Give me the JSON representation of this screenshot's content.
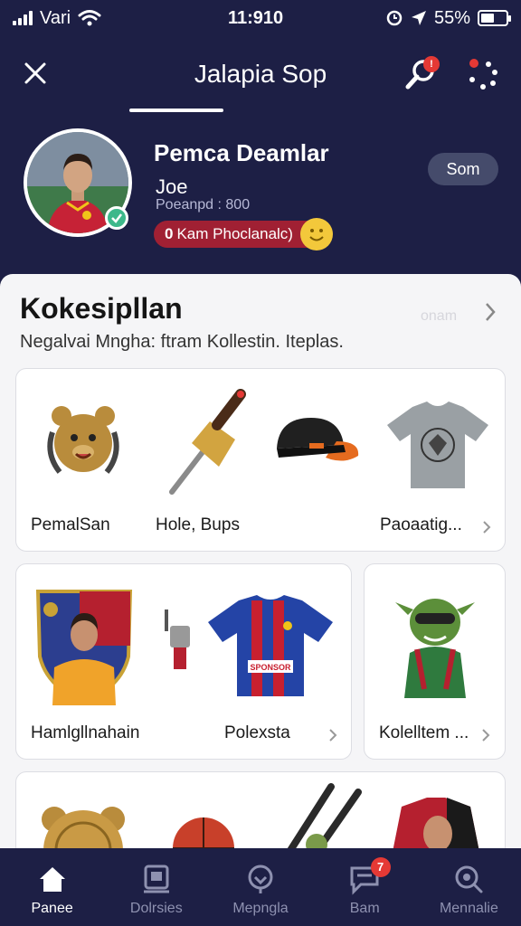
{
  "status_bar": {
    "carrier": "Vari",
    "time": "11:910",
    "battery_text": "55%",
    "battery_level": 0.55
  },
  "nav": {
    "close_icon": "close-icon",
    "title": "Jalapia Sop",
    "search_badge": "!",
    "menu_icon": "dots-icon"
  },
  "profile": {
    "name": "Pemca Deamlar",
    "username": "Joe",
    "stat": "Poeanpd : 800",
    "pill_number": "0",
    "pill_text": "Kam Phoclanalc)",
    "follow_label": "Som"
  },
  "collection": {
    "title": "Kokesipllan",
    "hint": "onam",
    "subtitle": "Negalvai Mngha: ftram Kollestin. Iteplas.",
    "card1": {
      "label_left": "PemalSan",
      "label_mid": "Hole, Bups",
      "label_right": "Paoaatig..."
    },
    "card2": {
      "label_left": "Hamlgllnahain",
      "label_right": "Polexsta"
    },
    "card3": {
      "label": "Kolelltem ..."
    }
  },
  "tabs": [
    {
      "label": "Panee",
      "icon": "home-icon",
      "active": true
    },
    {
      "label": "Dolrsies",
      "icon": "collection-icon",
      "active": false
    },
    {
      "label": "Mepngla",
      "icon": "map-icon",
      "active": false
    },
    {
      "label": "Bam",
      "icon": "chat-icon",
      "active": false,
      "badge": "7"
    },
    {
      "label": "Mennalie",
      "icon": "search-icon",
      "active": false
    }
  ],
  "colors": {
    "background": "#1d1f45",
    "accent_red": "#e53935",
    "online_green": "#3db88a",
    "sheet": "#f5f5f7"
  }
}
